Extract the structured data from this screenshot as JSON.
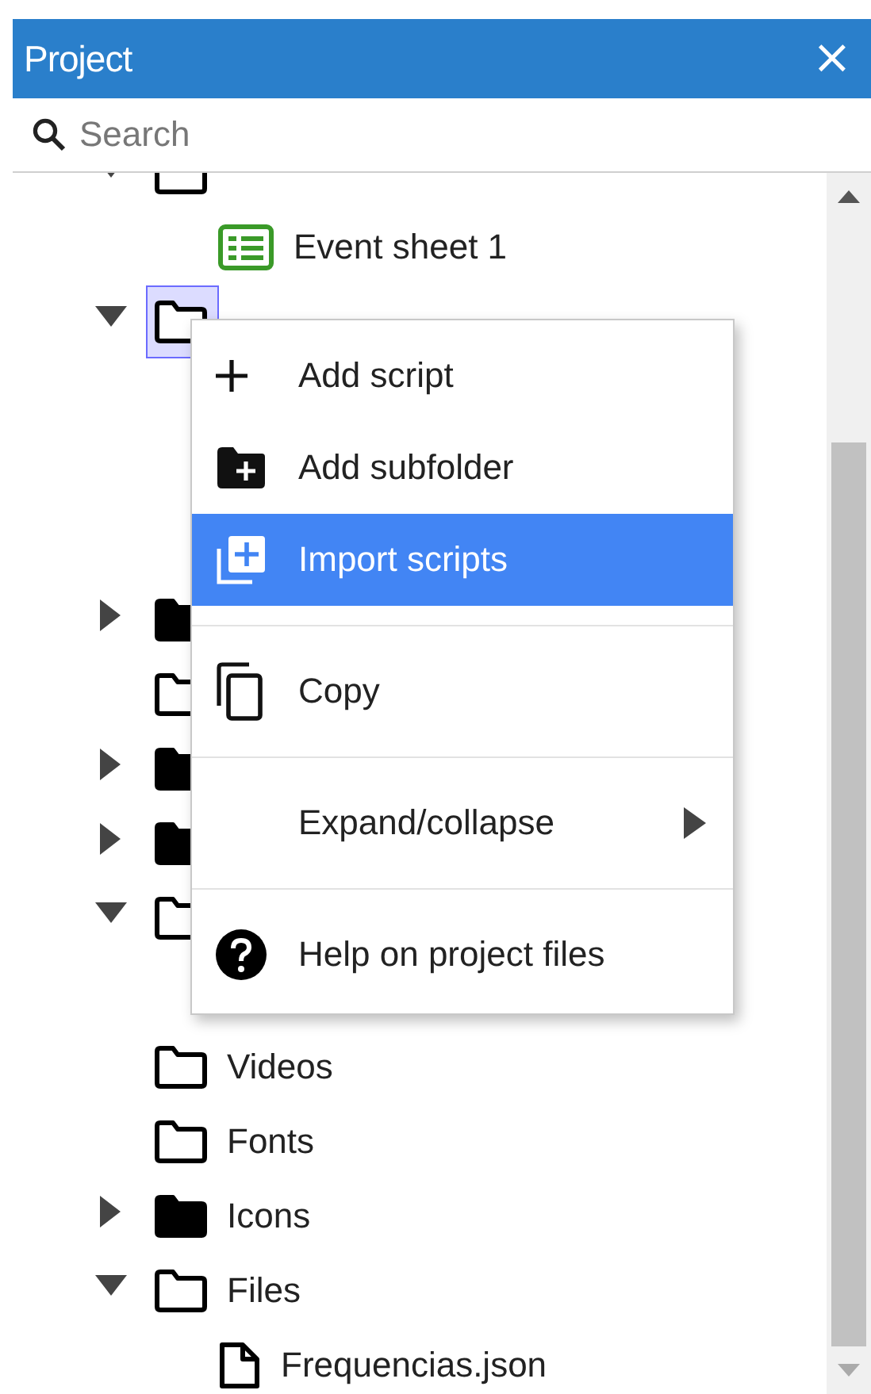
{
  "panel": {
    "title": "Project",
    "close": "×"
  },
  "search": {
    "placeholder": "Search"
  },
  "tree": [
    {
      "kind": "folder",
      "expandable": true,
      "expanded": true,
      "selected": false,
      "children": [
        {
          "label": "Event sheet 1",
          "kind": "event-sheet",
          "selected": false
        }
      ]
    },
    {
      "kind": "folder",
      "expandable": true,
      "expanded": true,
      "selected": true
    },
    {
      "kind": "folder",
      "expandable": true,
      "expanded": false,
      "selected": false
    },
    {
      "kind": "folder",
      "expandable": false,
      "selected": false
    },
    {
      "kind": "folder",
      "expandable": true,
      "expanded": false,
      "selected": false
    },
    {
      "kind": "folder",
      "expandable": true,
      "expanded": false,
      "selected": false
    },
    {
      "kind": "folder",
      "expandable": true,
      "expanded": true,
      "selected": false
    },
    {
      "label": "Videos",
      "kind": "folder",
      "expandable": false,
      "selected": false
    },
    {
      "label": "Fonts",
      "kind": "folder",
      "expandable": false,
      "selected": false
    },
    {
      "label": "Icons",
      "kind": "folder",
      "expandable": true,
      "expanded": false,
      "selected": false
    },
    {
      "label": "Files",
      "kind": "folder",
      "expandable": true,
      "expanded": true,
      "selected": false,
      "children": [
        {
          "label": "Frequencias.json",
          "kind": "file",
          "selected": false
        }
      ]
    }
  ],
  "context_menu": [
    {
      "kind": "command",
      "label": "Add script",
      "selected": false
    },
    {
      "kind": "command",
      "label": "Add subfolder",
      "selected": false
    },
    {
      "kind": "command",
      "label": "Import scripts",
      "selected": true
    },
    {
      "kind": "separator"
    },
    {
      "kind": "command",
      "label": "Copy",
      "selected": false
    },
    {
      "kind": "separator"
    },
    {
      "kind": "submenu",
      "label": "Expand/collapse",
      "selected": false
    },
    {
      "kind": "separator"
    },
    {
      "kind": "command",
      "label": "Help on project files",
      "selected": false
    }
  ]
}
